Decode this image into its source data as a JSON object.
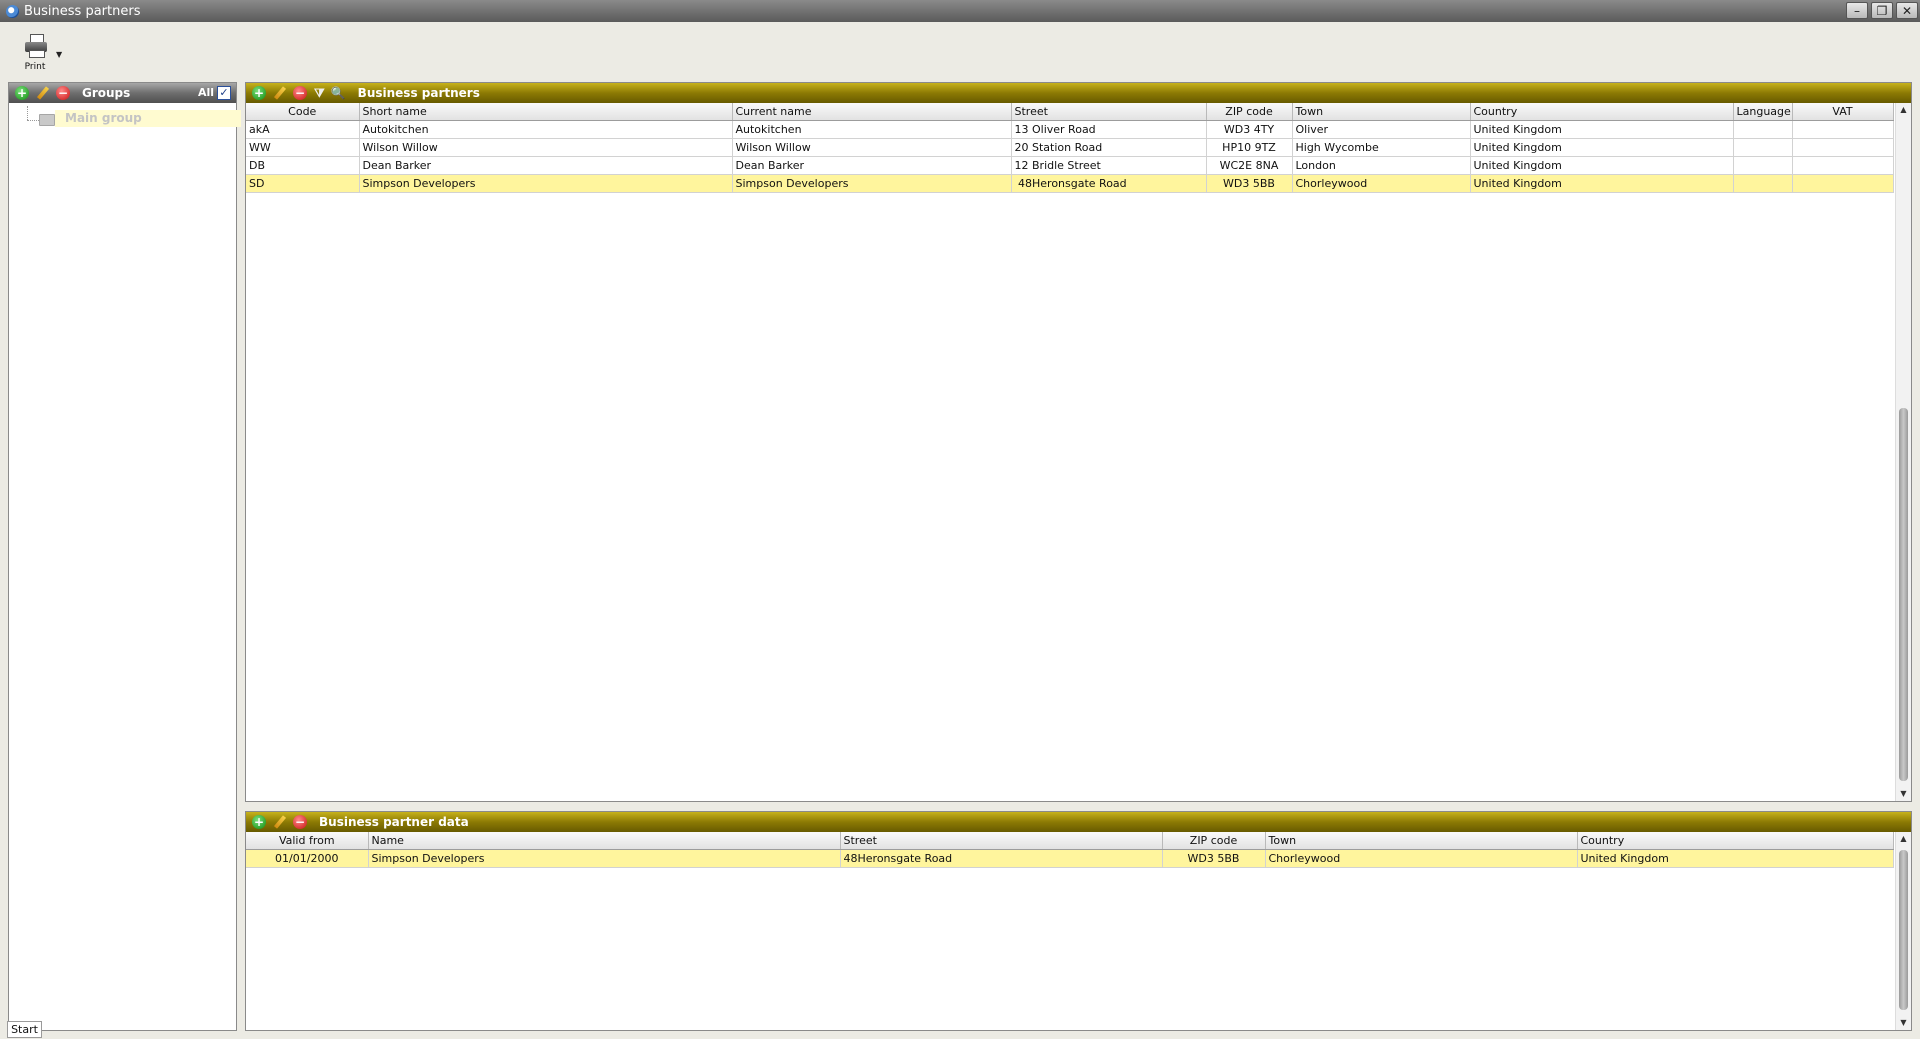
{
  "window": {
    "title": "Business partners",
    "buttons": {
      "minimize": "–",
      "maximize": "❐",
      "close": "✕"
    }
  },
  "toolbar": {
    "print_label": "Print",
    "print_dropdown": "▼"
  },
  "groups_panel": {
    "title": "Groups",
    "all_label": "All",
    "all_checked": true,
    "check_mark": "✓",
    "tree": [
      {
        "label": "Main group",
        "selected": true
      }
    ]
  },
  "partners_panel": {
    "title": "Business partners",
    "columns": [
      "Code",
      "Short name",
      "Current name",
      "Street",
      "ZIP code",
      "Town",
      "Country",
      "Language",
      "VAT"
    ],
    "rows": [
      {
        "code": "akA",
        "short_name": "Autokitchen",
        "current_name": "Autokitchen",
        "street": "13 Oliver Road",
        "zip": "WD3 4TY",
        "town": "Oliver",
        "country": "United Kingdom",
        "language": "",
        "vat": "",
        "selected": false
      },
      {
        "code": "WW",
        "short_name": "Wilson Willow",
        "current_name": "Wilson Willow",
        "street": "20 Station Road",
        "zip": "HP10 9TZ",
        "town": "High Wycombe",
        "country": "United Kingdom",
        "language": "",
        "vat": "",
        "selected": false
      },
      {
        "code": "DB",
        "short_name": "Dean Barker",
        "current_name": "Dean Barker",
        "street": "12 Bridle Street",
        "zip": "WC2E 8NA",
        "town": "London",
        "country": "United Kingdom",
        "language": "",
        "vat": "",
        "selected": false
      },
      {
        "code": "SD",
        "short_name": "Simpson Developers",
        "current_name": "Simpson Developers",
        "street": " 48Heronsgate Road",
        "zip": "WD3 5BB",
        "town": "Chorleywood",
        "country": "United Kingdom",
        "language": "",
        "vat": "",
        "selected": true
      }
    ]
  },
  "partner_data_panel": {
    "title": "Business partner data",
    "columns": [
      "Valid from",
      "Name",
      "Street",
      "ZIP code",
      "Town",
      "Country"
    ],
    "rows": [
      {
        "valid_from": "01/01/2000",
        "name": "Simpson Developers",
        "street": "48Heronsgate Road",
        "zip": "WD3 5BB",
        "town": "Chorleywood",
        "country": "United Kingdom",
        "selected": true
      }
    ]
  },
  "icons": {
    "add": "+",
    "delete": "−",
    "filter": "⧩",
    "search": "🔍"
  },
  "colors": {
    "panel_header": "#8c7a04",
    "selected_row": "#fff59d",
    "titlebar": "#6e6e6e"
  },
  "status": {
    "start_tab": "Start"
  }
}
